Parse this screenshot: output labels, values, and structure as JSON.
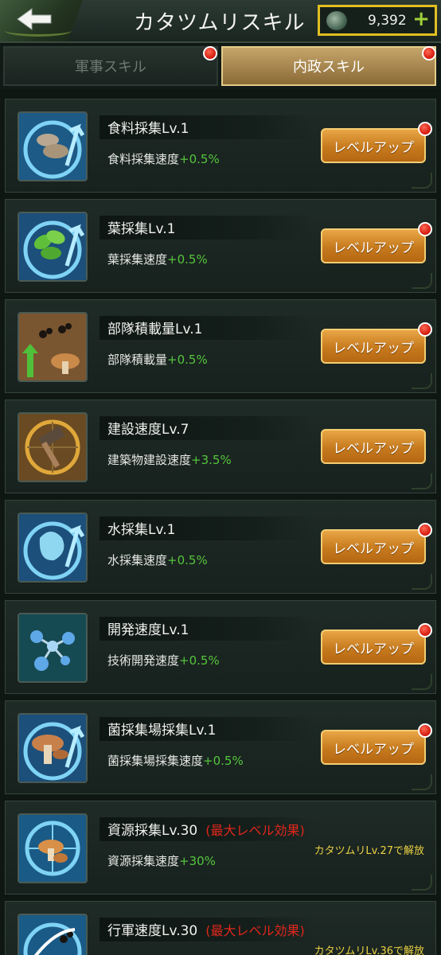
{
  "header": {
    "title": "カタツムリスキル",
    "currency_amount": "9,392",
    "plus_label": "+"
  },
  "tabs": [
    {
      "label": "軍事スキル",
      "active": false,
      "badge": true
    },
    {
      "label": "内政スキル",
      "active": true,
      "badge": true
    }
  ],
  "colors": {
    "accent_gold": "#e2bf22",
    "button_orange": "#d98d2c",
    "bonus_green": "#55c53d",
    "max_red": "#e0261c",
    "unlock_yellow": "#ead043"
  },
  "skills": [
    {
      "name": "食料採集Lv.1",
      "effect_label": "食料採集速度",
      "bonus": "+0.5%",
      "button": "レベルアップ",
      "badge": true,
      "icon": "woodlouse-harvest-icon"
    },
    {
      "name": "葉採集Lv.1",
      "effect_label": "葉採集速度",
      "bonus": "+0.5%",
      "button": "レベルアップ",
      "badge": true,
      "icon": "leaf-harvest-icon"
    },
    {
      "name": "部隊積載量Lv.1",
      "effect_label": "部隊積載量",
      "bonus": "+0.5%",
      "button": "レベルアップ",
      "badge": true,
      "icon": "ant-load-icon"
    },
    {
      "name": "建設速度Lv.7",
      "effect_label": "建築物建設速度",
      "bonus": "+3.5%",
      "button": "レベルアップ",
      "badge": false,
      "icon": "hammer-build-icon"
    },
    {
      "name": "水採集Lv.1",
      "effect_label": "水採集速度",
      "bonus": "+0.5%",
      "button": "レベルアップ",
      "badge": true,
      "icon": "water-drop-icon"
    },
    {
      "name": "開発速度Lv.1",
      "effect_label": "技術開発速度",
      "bonus": "+0.5%",
      "button": "レベルアップ",
      "badge": true,
      "icon": "molecule-research-icon"
    },
    {
      "name": "菌採集場採集Lv.1",
      "effect_label": "菌採集場採集速度",
      "bonus": "+0.5%",
      "button": "レベルアップ",
      "badge": true,
      "icon": "mushroom-harvest-icon"
    },
    {
      "name": "資源採集Lv.30",
      "max_label": "(最大レベル効果)",
      "effect_label": "資源採集速度",
      "bonus": "+30%",
      "unlock": "カタツムリLv.27で解放",
      "icon": "resource-compass-icon"
    },
    {
      "name": "行軍速度Lv.30",
      "max_label": "(最大レベル効果)",
      "effect_label": "",
      "bonus": "",
      "unlock": "カタツムリLv.36で解放",
      "icon": "march-speed-icon"
    }
  ]
}
